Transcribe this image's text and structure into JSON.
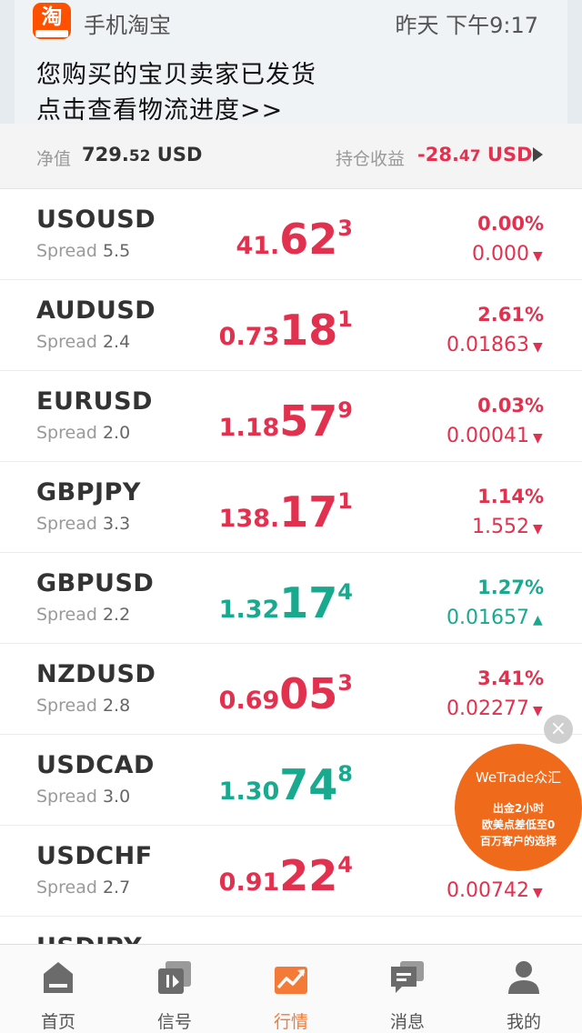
{
  "notification": {
    "app_icon_text": "淘",
    "app_name": "手机淘宝",
    "time": "昨天 下午9:17",
    "line1": "您购买的宝贝卖家已发货",
    "line2": "点击查看物流进度>>"
  },
  "summary": {
    "equity_label": "净值",
    "equity_int": "729.",
    "equity_dec": "52",
    "equity_unit": " USD",
    "pl_label": "持仓收益",
    "pl_int": "-28.",
    "pl_dec": "47",
    "pl_unit": " USD"
  },
  "spread_label": "Spread",
  "quotes": [
    {
      "symbol": "USOUSD",
      "spread": "5.5",
      "p1": "41.",
      "p2": "62",
      "p3": "3",
      "pct": "0.00%",
      "chg": "0.000",
      "dir": "down",
      "color": "red"
    },
    {
      "symbol": "AUDUSD",
      "spread": "2.4",
      "p1": "0.73",
      "p2": "18",
      "p3": "1",
      "pct": "2.61%",
      "chg": "0.01863",
      "dir": "down",
      "color": "red"
    },
    {
      "symbol": "EURUSD",
      "spread": "2.0",
      "p1": "1.18",
      "p2": "57",
      "p3": "9",
      "pct": "0.03%",
      "chg": "0.00041",
      "dir": "down",
      "color": "red"
    },
    {
      "symbol": "GBPJPY",
      "spread": "3.3",
      "p1": "138.",
      "p2": "17",
      "p3": "1",
      "pct": "1.14%",
      "chg": "1.552",
      "dir": "down",
      "color": "red"
    },
    {
      "symbol": "GBPUSD",
      "spread": "2.2",
      "p1": "1.32",
      "p2": "17",
      "p3": "4",
      "pct": "1.27%",
      "chg": "0.01657",
      "dir": "up",
      "color": "green"
    },
    {
      "symbol": "NZDUSD",
      "spread": "2.8",
      "p1": "0.69",
      "p2": "05",
      "p3": "3",
      "pct": "3.41%",
      "chg": "0.02277",
      "dir": "down",
      "color": "red"
    },
    {
      "symbol": "USDCAD",
      "spread": "3.0",
      "p1": "1.30",
      "p2": "74",
      "p3": "8",
      "pct": "",
      "chg": "",
      "dir": "up",
      "color": "green"
    },
    {
      "symbol": "USDCHF",
      "spread": "2.7",
      "p1": "0.91",
      "p2": "22",
      "p3": "4",
      "pct": "",
      "chg": "0.00742",
      "dir": "down",
      "color": "red"
    },
    {
      "symbol": "USDJPY",
      "spread": "",
      "p1": "",
      "p2": "",
      "p3": "",
      "pct": "",
      "chg": "",
      "dir": "down",
      "color": "red"
    }
  ],
  "ad": {
    "brand": "WeTrade众汇",
    "line1": "出金2小时",
    "line2": "欧美点差低至0",
    "line3": "百万客户的选择",
    "close_glyph": "×"
  },
  "tabs": [
    {
      "label": "首页",
      "icon": "home-icon"
    },
    {
      "label": "信号",
      "icon": "signal-icon"
    },
    {
      "label": "行情",
      "icon": "market-icon"
    },
    {
      "label": "消息",
      "icon": "message-icon"
    },
    {
      "label": "我的",
      "icon": "profile-icon"
    }
  ],
  "active_tab": 2,
  "colors": {
    "up": "#19a98e",
    "down": "#e2314f",
    "active_tab": "#f47a37",
    "icon": "#6b6b6b"
  }
}
